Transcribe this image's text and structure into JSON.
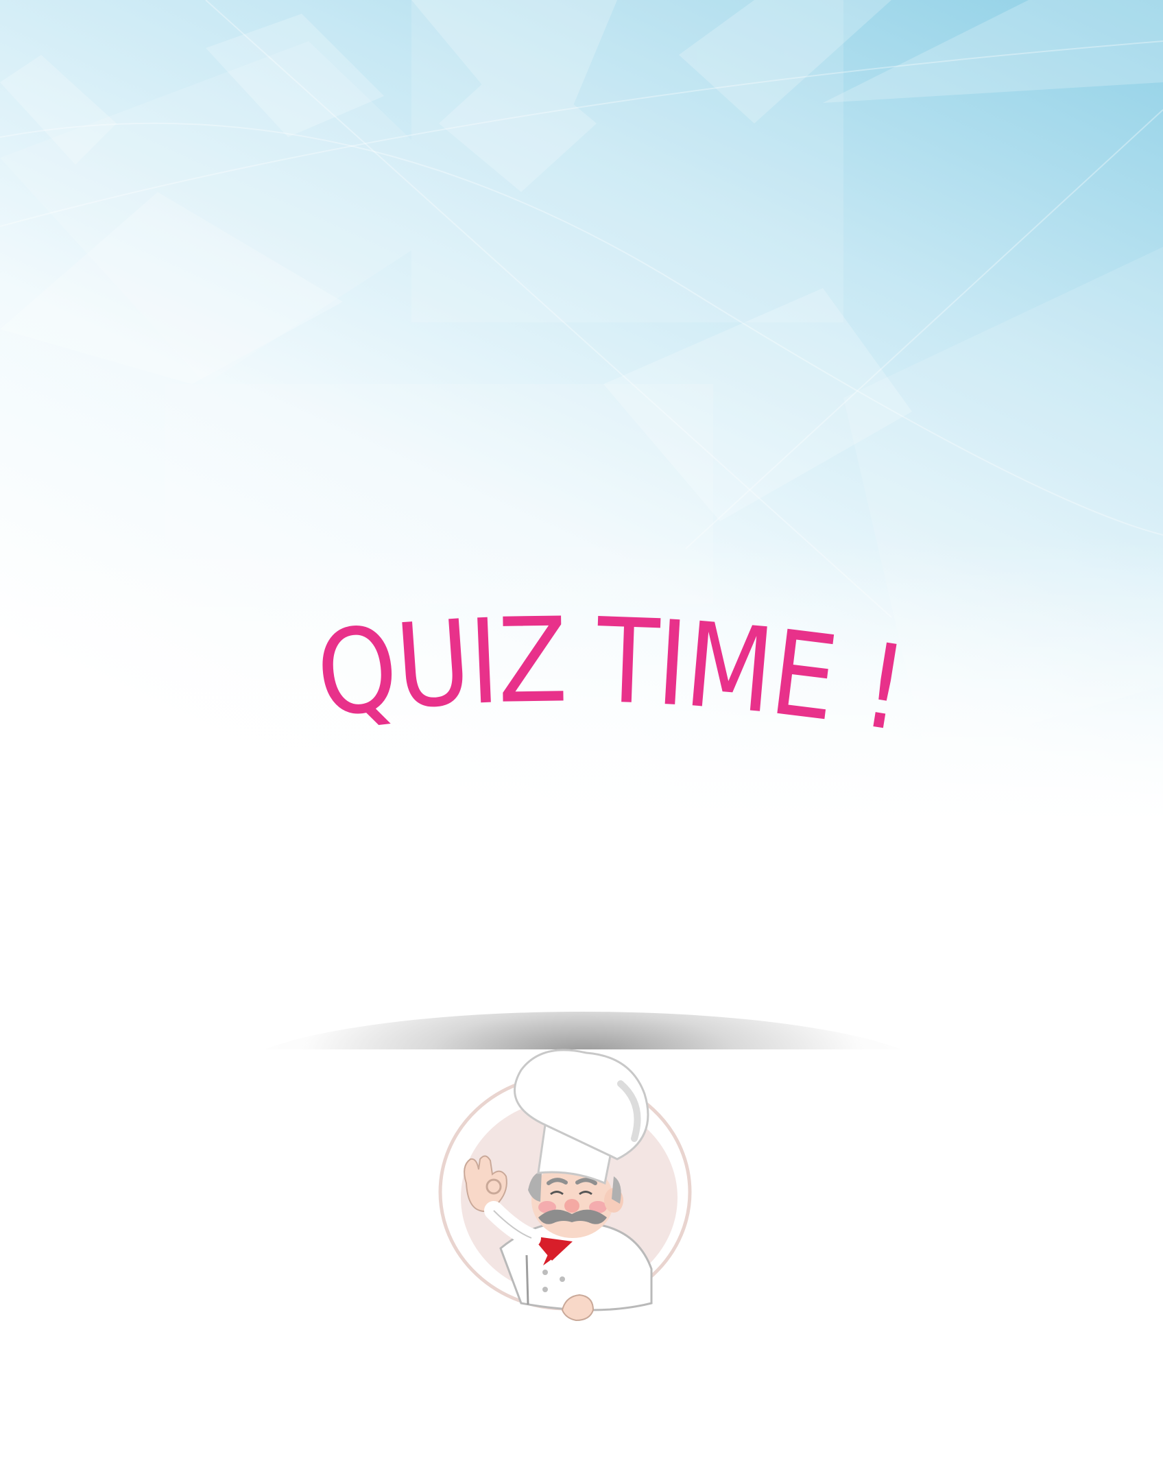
{
  "title": {
    "text": "QUIZ TIME !",
    "color": "#e8318a"
  },
  "background": {
    "top_color": "#8fd0e6",
    "bottom_color": "#ffffff"
  },
  "illustration": {
    "subject": "chef-mascot",
    "gesture": "ok-hand",
    "accent_color": "#d81e2a"
  }
}
